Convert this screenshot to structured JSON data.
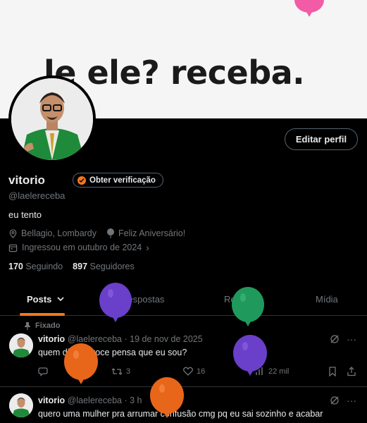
{
  "banner": {
    "text": "le ele? receba."
  },
  "profile": {
    "name": "vitorio",
    "handle": "@laelereceba",
    "bio": "eu tento",
    "location": "Bellagio, Lombardy",
    "birthday": "Feliz Aniversário!",
    "joined": "Ingressou em outubro de 2024",
    "edit_label": "Editar perfil",
    "verify_label": "Obter verificação",
    "following_count": "170",
    "following_label": "Seguindo",
    "followers_count": "897",
    "followers_label": "Seguidores"
  },
  "tabs": [
    {
      "label": "Posts",
      "active": true
    },
    {
      "label": "Respostas",
      "active": false
    },
    {
      "label": "Reposts",
      "active": false
    },
    {
      "label": "Mídia",
      "active": false
    }
  ],
  "pinned_label": "Fixado",
  "posts": [
    {
      "name": "vitorio",
      "handle": "@laelereceba",
      "date": "· 19 de nov de 2025",
      "text": "quem diabos voce pensa que eu sou?",
      "replies": "",
      "reposts": "3",
      "likes": "16",
      "views": "22 mil"
    },
    {
      "name": "vitorio",
      "handle": "@laelereceba",
      "date": "· 3 h",
      "text": "quero uma mulher pra arrumar confusão cmg pq eu sai sozinho e acabar"
    }
  ],
  "colors": {
    "accent": "#f4761f",
    "balloon_pink": "#f25ba6",
    "balloon_purple": "#6a3fc9",
    "balloon_green": "#1f9a5c",
    "balloon_orange": "#e8661a"
  }
}
